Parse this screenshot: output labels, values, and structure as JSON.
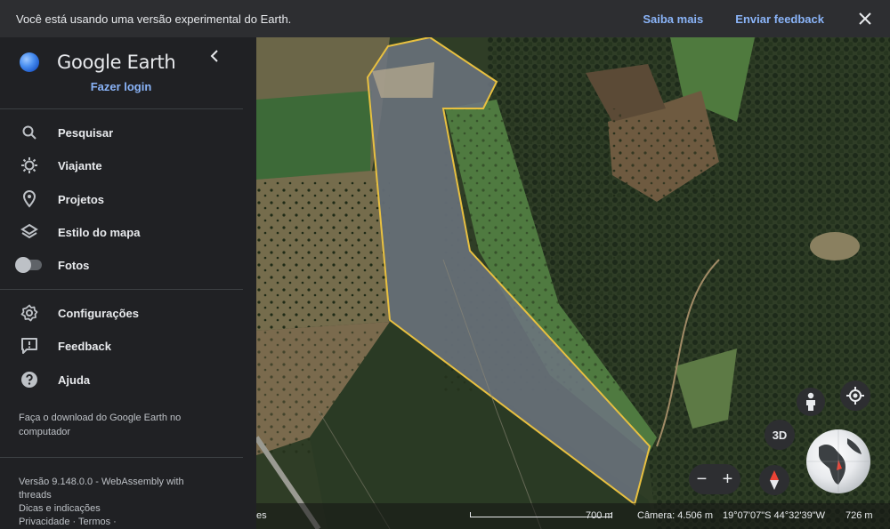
{
  "banner": {
    "message": "Você está usando uma versão experimental do Earth.",
    "learn_more": "Saiba mais",
    "feedback": "Enviar feedback"
  },
  "sidebar": {
    "app_name": "Google Earth",
    "login": "Fazer login",
    "items": [
      {
        "label": "Pesquisar",
        "icon": "search-icon"
      },
      {
        "label": "Viajante",
        "icon": "voyager-icon"
      },
      {
        "label": "Projetos",
        "icon": "projects-icon"
      },
      {
        "label": "Estilo do mapa",
        "icon": "map-style-icon"
      },
      {
        "label": "Fotos",
        "icon": "toggle-icon"
      },
      {
        "label": "Configurações",
        "icon": "gear-icon"
      },
      {
        "label": "Feedback",
        "icon": "feedback-icon"
      },
      {
        "label": "Ajuda",
        "icon": "help-icon"
      }
    ],
    "download_text": "Faça o download do Google Earth no computador",
    "version_line1": "Versão 9.148.0.0 - WebAssembly with",
    "version_line2": "threads",
    "tips": "Dicas e indicações",
    "privacy": "Privacidade · Termos ·"
  },
  "statusbar": {
    "left_fragment": "es",
    "scale": "700 m",
    "camera": "Câmera: 4.506 m",
    "coords": "19°07'07\"S 44°32'39\"W",
    "elevation": "726 m"
  },
  "controls": {
    "btn_3d": "3D",
    "zoom_out": "−",
    "zoom_in": "+"
  },
  "colors": {
    "accent": "#8ab4f8",
    "polygon_stroke": "#e8c040",
    "panel_bg": "#202124"
  }
}
